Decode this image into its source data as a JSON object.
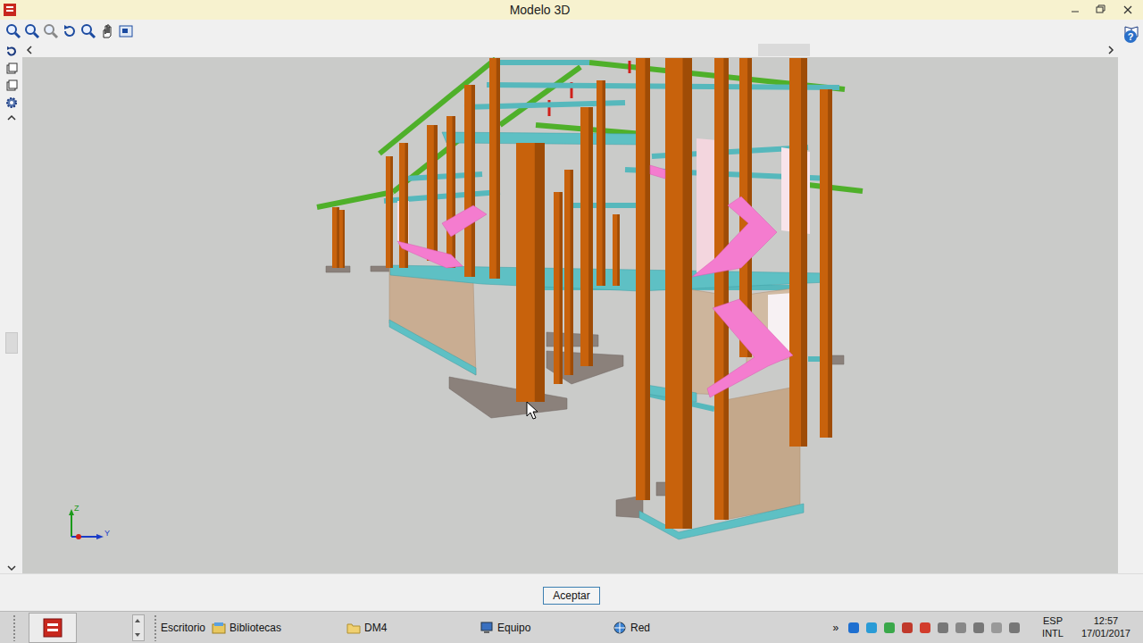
{
  "window": {
    "title": "Modelo 3D"
  },
  "viewport": {
    "axes": [
      {
        "label": "Z",
        "color": "#1a9a1a"
      },
      {
        "label": "Y",
        "color": "#1a3cc8"
      }
    ]
  },
  "help": "?",
  "buttons": [
    "Aceptar"
  ],
  "taskbar": {
    "items": [
      "Escritorio",
      "Bibliotecas",
      "DM4",
      "Equipo",
      "Red"
    ],
    "overflow": "»",
    "tray": {
      "language": "ESP",
      "layout": "INTL",
      "time": "12:57",
      "date": "17/01/2017"
    }
  }
}
